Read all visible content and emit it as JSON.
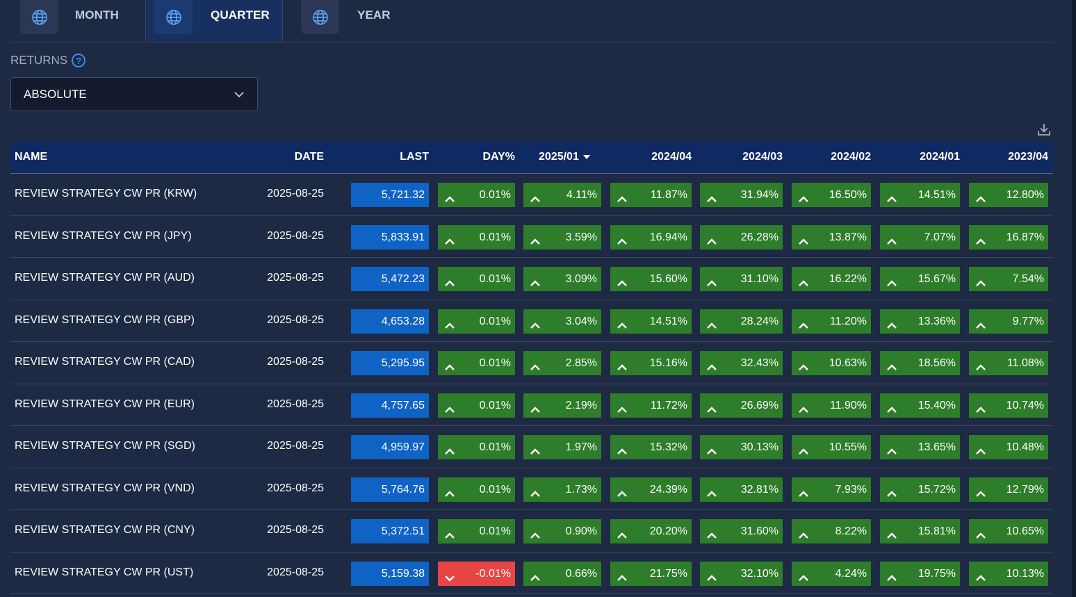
{
  "tabs": [
    {
      "label": "MONTH",
      "icon": "globe-icon",
      "active": false
    },
    {
      "label": "QUARTER",
      "icon": "globe-icon",
      "active": true
    },
    {
      "label": "YEAR",
      "icon": "globe-icon",
      "active": false
    }
  ],
  "returns": {
    "label": "RETURNS",
    "help_icon": "?",
    "selected": "ABSOLUTE"
  },
  "table": {
    "headers": [
      "NAME",
      "DATE",
      "LAST",
      "DAY%",
      "2025/01",
      "2024/04",
      "2024/03",
      "2024/02",
      "2024/01",
      "2023/04"
    ],
    "sorted_column": "2025/01",
    "rows": [
      {
        "name": "REVIEW STRATEGY CW PR (KRW)",
        "date": "2025-08-25",
        "last": "5,721.32",
        "day": "0.01%",
        "q2025_01": "4.11%",
        "q2024_04": "11.87%",
        "q2024_03": "31.94%",
        "q2024_02": "16.50%",
        "q2024_01": "14.51%",
        "q2023_04": "12.80%"
      },
      {
        "name": "REVIEW STRATEGY CW PR (JPY)",
        "date": "2025-08-25",
        "last": "5,833.91",
        "day": "0.01%",
        "q2025_01": "3.59%",
        "q2024_04": "16.94%",
        "q2024_03": "26.28%",
        "q2024_02": "13.87%",
        "q2024_01": "7.07%",
        "q2023_04": "16.87%"
      },
      {
        "name": "REVIEW STRATEGY CW PR (AUD)",
        "date": "2025-08-25",
        "last": "5,472.23",
        "day": "0.01%",
        "q2025_01": "3.09%",
        "q2024_04": "15.60%",
        "q2024_03": "31.10%",
        "q2024_02": "16.22%",
        "q2024_01": "15.67%",
        "q2023_04": "7.54%"
      },
      {
        "name": "REVIEW STRATEGY CW PR (GBP)",
        "date": "2025-08-25",
        "last": "4,653.28",
        "day": "0.01%",
        "q2025_01": "3.04%",
        "q2024_04": "14.51%",
        "q2024_03": "28.24%",
        "q2024_02": "11.20%",
        "q2024_01": "13.36%",
        "q2023_04": "9.77%"
      },
      {
        "name": "REVIEW STRATEGY CW PR (CAD)",
        "date": "2025-08-25",
        "last": "5,295.95",
        "day": "0.01%",
        "q2025_01": "2.85%",
        "q2024_04": "15.16%",
        "q2024_03": "32.43%",
        "q2024_02": "10.63%",
        "q2024_01": "18.56%",
        "q2023_04": "11.08%"
      },
      {
        "name": "REVIEW STRATEGY CW PR (EUR)",
        "date": "2025-08-25",
        "last": "4,757.65",
        "day": "0.01%",
        "q2025_01": "2.19%",
        "q2024_04": "11.72%",
        "q2024_03": "26.69%",
        "q2024_02": "11.90%",
        "q2024_01": "15.40%",
        "q2023_04": "10.74%"
      },
      {
        "name": "REVIEW STRATEGY CW PR (SGD)",
        "date": "2025-08-25",
        "last": "4,959.97",
        "day": "0.01%",
        "q2025_01": "1.97%",
        "q2024_04": "15.32%",
        "q2024_03": "30.13%",
        "q2024_02": "10.55%",
        "q2024_01": "13.65%",
        "q2023_04": "10.48%"
      },
      {
        "name": "REVIEW STRATEGY CW PR (VND)",
        "date": "2025-08-25",
        "last": "5,764.76",
        "day": "0.01%",
        "q2025_01": "1.73%",
        "q2024_04": "24.39%",
        "q2024_03": "32.81%",
        "q2024_02": "7.93%",
        "q2024_01": "15.72%",
        "q2023_04": "12.79%"
      },
      {
        "name": "REVIEW STRATEGY CW PR (CNY)",
        "date": "2025-08-25",
        "last": "5,372.51",
        "day": "0.01%",
        "q2025_01": "0.90%",
        "q2024_04": "20.20%",
        "q2024_03": "31.60%",
        "q2024_02": "8.22%",
        "q2024_01": "15.81%",
        "q2023_04": "10.65%"
      },
      {
        "name": "REVIEW STRATEGY CW PR (UST)",
        "date": "2025-08-25",
        "last": "5,159.38",
        "day": "-0.01%",
        "q2025_01": "0.66%",
        "q2024_04": "21.75%",
        "q2024_03": "32.10%",
        "q2024_02": "4.24%",
        "q2024_01": "19.75%",
        "q2023_04": "10.13%"
      }
    ]
  },
  "colors": {
    "positive": "#2d7d2a",
    "negative": "#e84545",
    "last_value": "#0f63c4",
    "header_bg": "#0f2a63",
    "page_bg": "#1e2943"
  }
}
